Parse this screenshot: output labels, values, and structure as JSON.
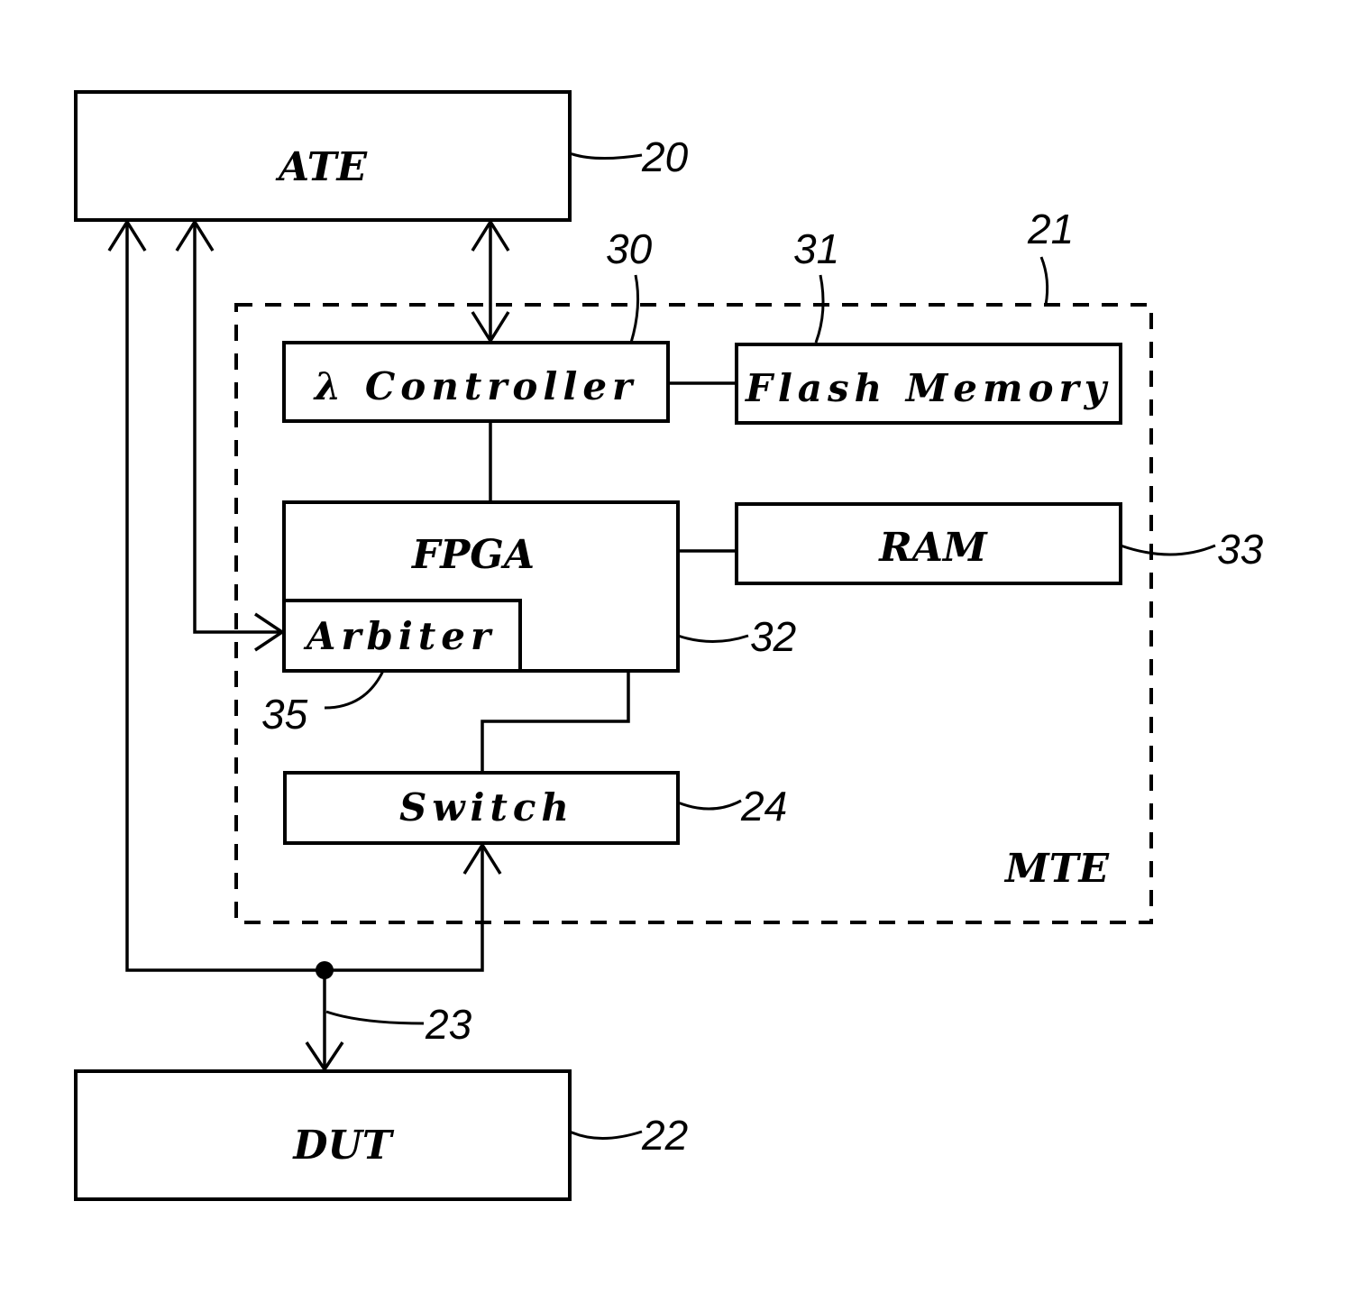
{
  "diagram": {
    "blocks": {
      "ate": {
        "label": "ATE",
        "ref": "20"
      },
      "controller": {
        "label": "λ Controller",
        "ref": "30"
      },
      "flash": {
        "label": "Flash Memory",
        "ref": "31"
      },
      "fpga": {
        "label": "FPGA",
        "ref": "32"
      },
      "ram": {
        "label": "RAM",
        "ref": "33"
      },
      "arbiter": {
        "label": "Arbiter",
        "ref": "35"
      },
      "switch": {
        "label": "Switch",
        "ref": "24"
      },
      "dut": {
        "label": "DUT",
        "ref": "22"
      }
    },
    "mte_group": {
      "label": "MTE",
      "ref": "21"
    },
    "bus": {
      "ref": "23"
    }
  }
}
